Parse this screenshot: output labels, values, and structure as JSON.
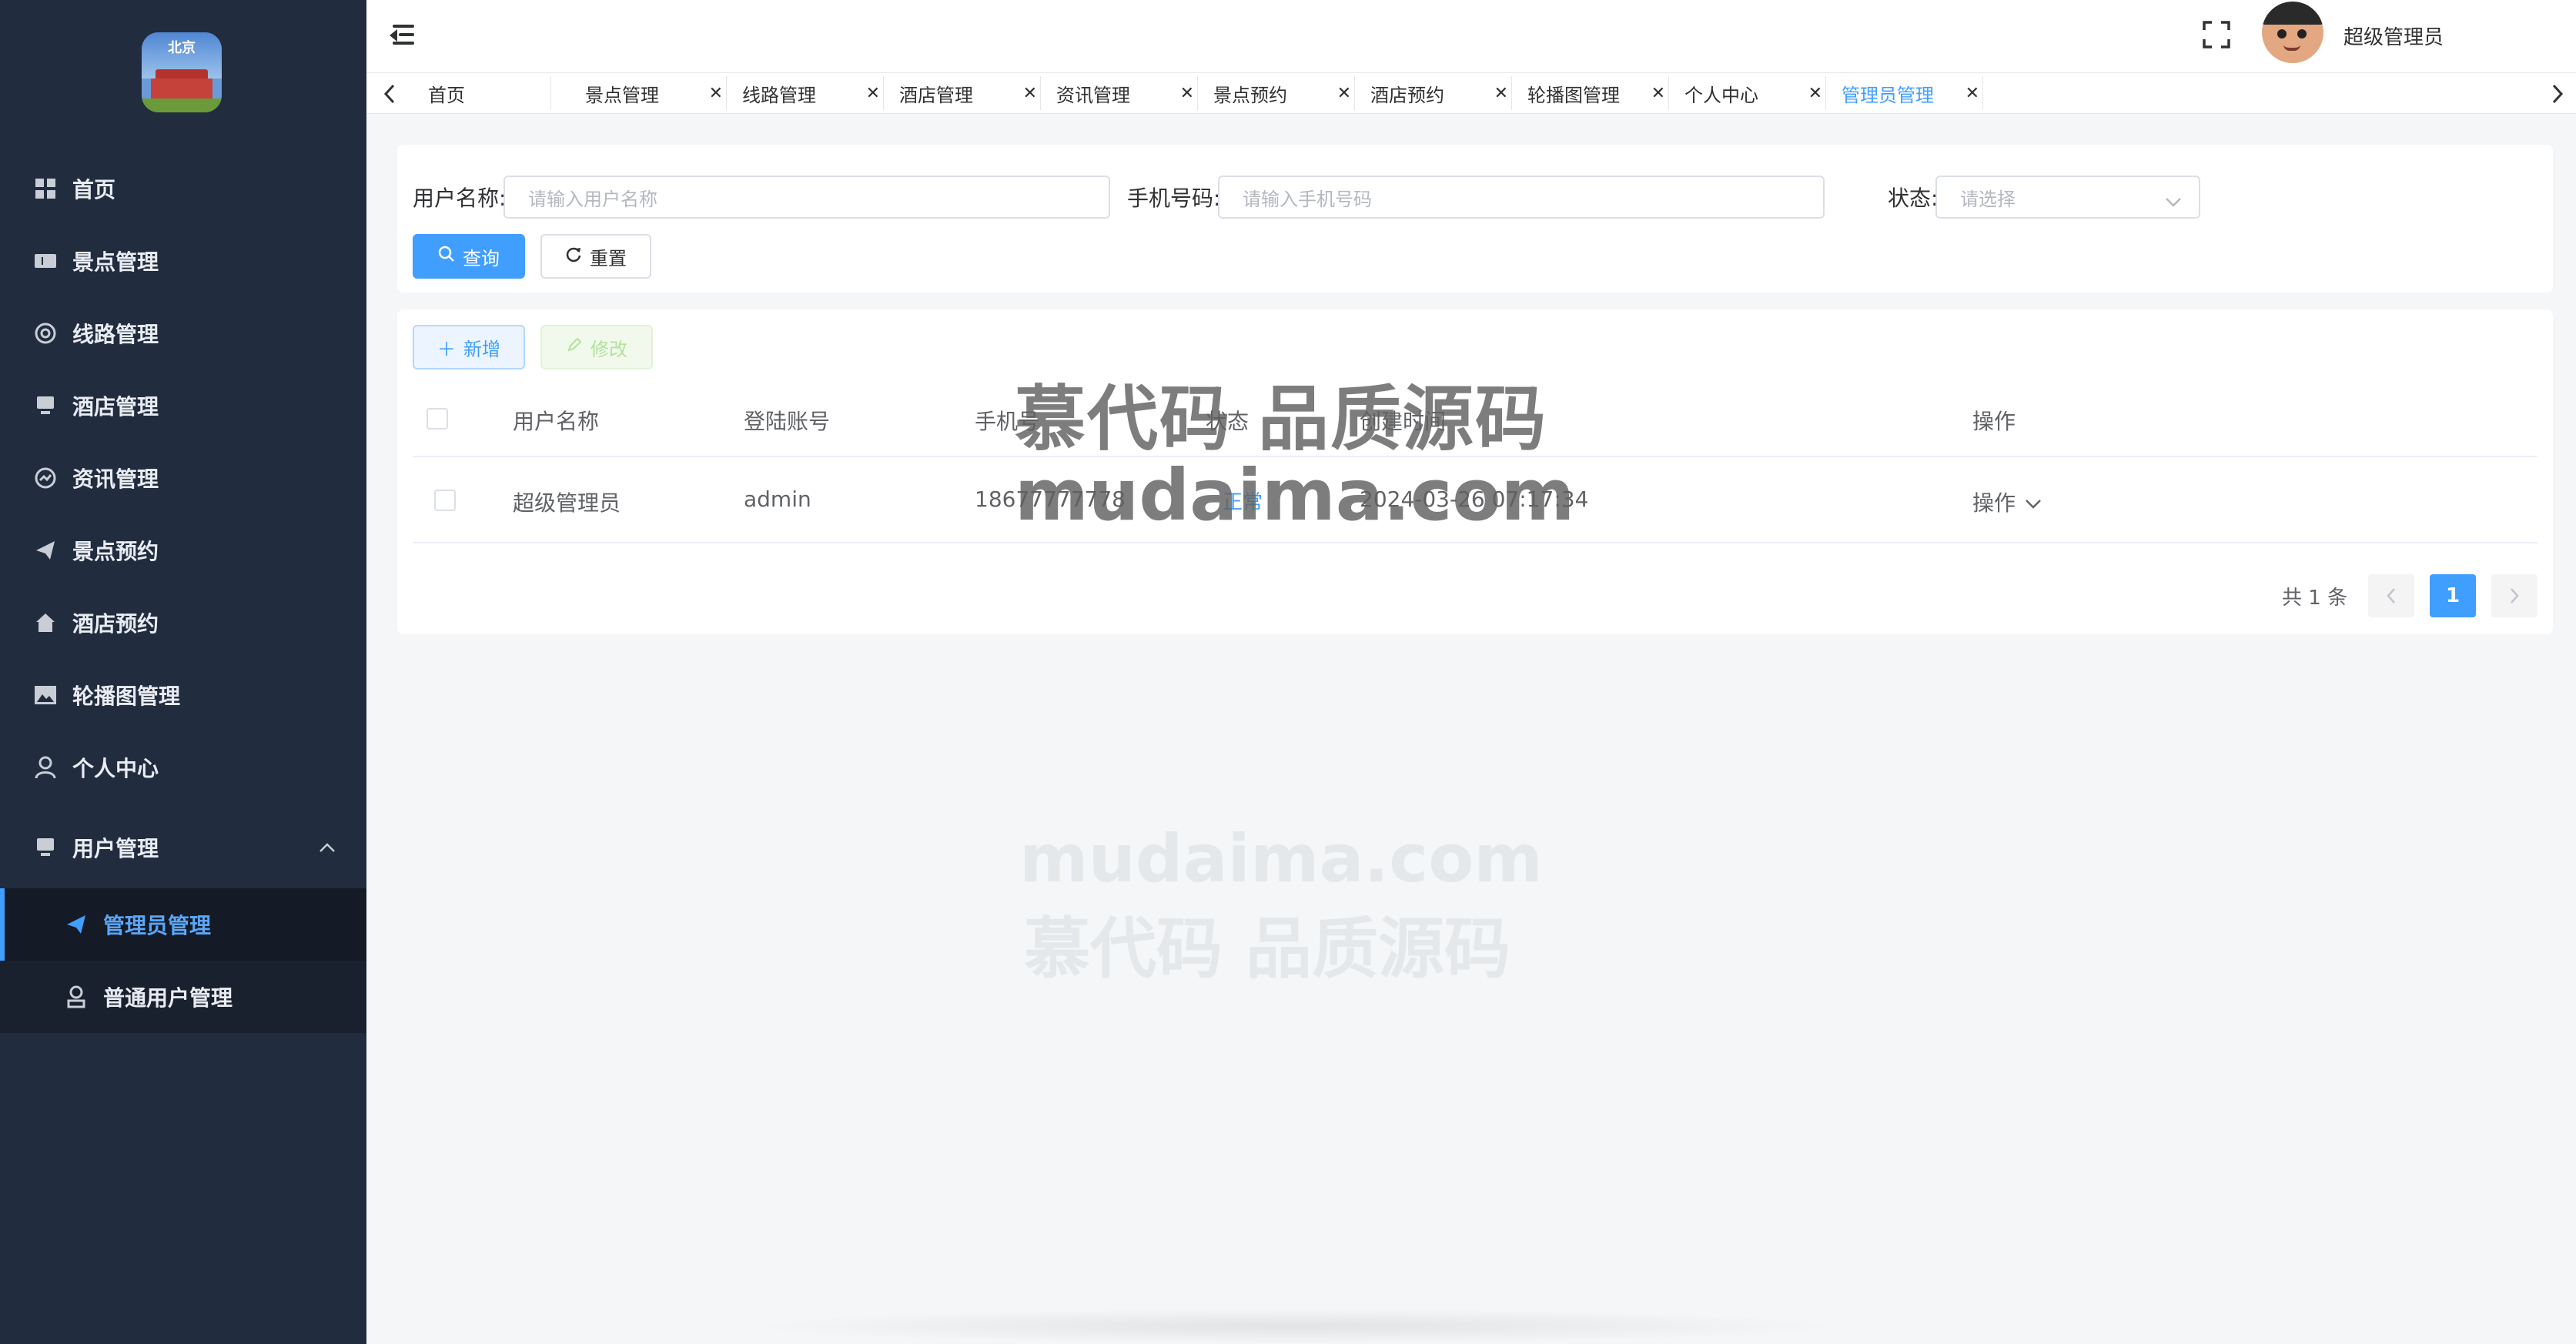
{
  "sidebar": {
    "logo_text": "北京",
    "items": [
      {
        "label": "首页"
      },
      {
        "label": "景点管理"
      },
      {
        "label": "线路管理"
      },
      {
        "label": "酒店管理"
      },
      {
        "label": "资讯管理"
      },
      {
        "label": "景点预约"
      },
      {
        "label": "酒店预约"
      },
      {
        "label": "轮播图管理"
      },
      {
        "label": "个人中心"
      },
      {
        "label": "用户管理"
      }
    ],
    "sub_items": [
      {
        "label": "管理员管理"
      },
      {
        "label": "普通用户管理"
      }
    ]
  },
  "header": {
    "username": "超级管理员"
  },
  "tabs": [
    {
      "label": "首页"
    },
    {
      "label": "景点管理"
    },
    {
      "label": "线路管理"
    },
    {
      "label": "酒店管理"
    },
    {
      "label": "资讯管理"
    },
    {
      "label": "景点预约"
    },
    {
      "label": "酒店预约"
    },
    {
      "label": "轮播图管理"
    },
    {
      "label": "个人中心"
    },
    {
      "label": "管理员管理"
    }
  ],
  "search": {
    "username_label": "用户名称:",
    "username_placeholder": "请输入用户名称",
    "phone_label": "手机号码:",
    "phone_placeholder": "请输入手机号码",
    "status_label": "状态:",
    "status_placeholder": "请选择",
    "query_label": "查询",
    "reset_label": "重置"
  },
  "toolbar": {
    "add_label": "新增",
    "edit_label": "修改"
  },
  "table": {
    "headers": [
      "用户名称",
      "登陆账号",
      "手机号",
      "状态",
      "创建时间",
      "操作"
    ],
    "rows": [
      {
        "name": "超级管理员",
        "account": "admin",
        "phone": "18677777778",
        "status": "正常",
        "created": "2024-03-26 07:17:34",
        "action": "操作"
      }
    ]
  },
  "pagination": {
    "total": "共 1 条",
    "current": "1"
  },
  "watermark": {
    "line1": "慕代码 品质源码",
    "line2": "mudaima.com"
  },
  "colors": {
    "sidebar_bg": "#212c3f",
    "primary": "#409eff"
  }
}
